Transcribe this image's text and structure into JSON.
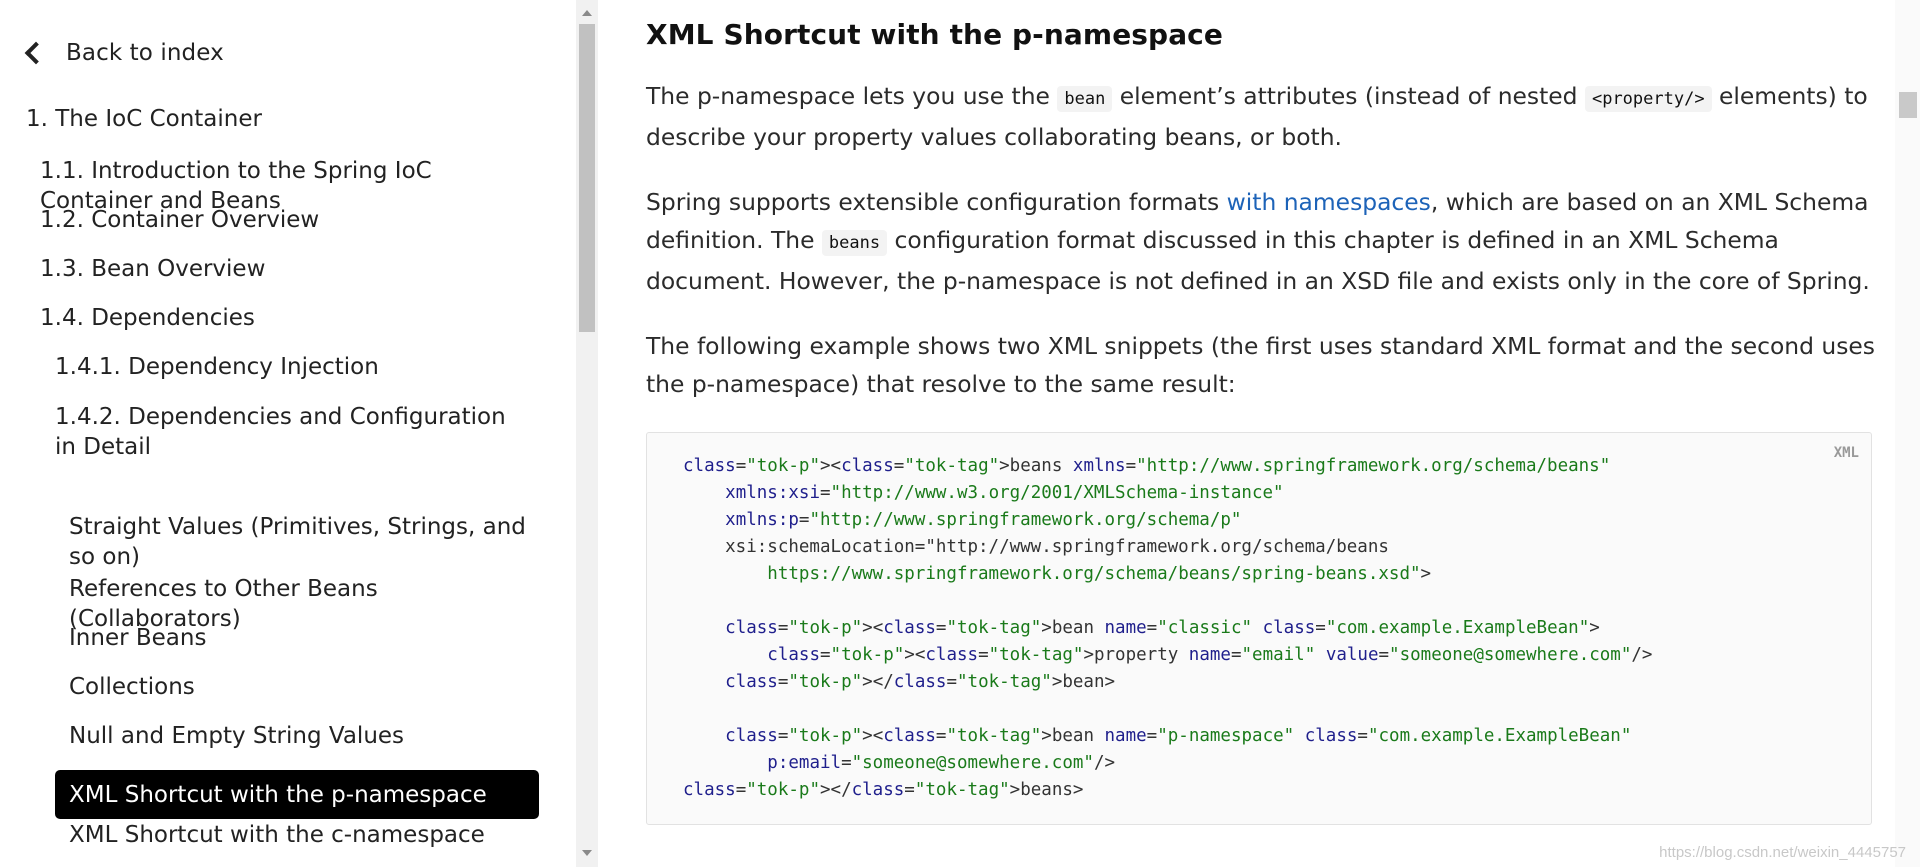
{
  "sidebar": {
    "back_label": "Back to index",
    "toc": [
      {
        "label": "1. The IoC Container",
        "level": 0
      },
      {
        "label": "1.1. Introduction to the Spring IoC Container and Beans",
        "level": 1
      },
      {
        "label": "1.2. Container Overview",
        "level": 1
      },
      {
        "label": "1.3. Bean Overview",
        "level": 1
      },
      {
        "label": "1.4. Dependencies",
        "level": 1
      },
      {
        "label": "1.4.1. Dependency Injection",
        "level": 2
      },
      {
        "label": "1.4.2. Dependencies and Configuration in Detail",
        "level": 2
      },
      {
        "label": "Straight Values (Primitives, Strings, and so on)",
        "level": 3
      },
      {
        "label": "References to Other Beans (Collaborators)",
        "level": 3
      },
      {
        "label": "Inner Beans",
        "level": 3
      },
      {
        "label": "Collections",
        "level": 3
      },
      {
        "label": "Null and Empty String Values",
        "level": 3
      },
      {
        "label": "XML Shortcut with the p-namespace",
        "level": 3,
        "active": true
      },
      {
        "label": "XML Shortcut with the c-namespace",
        "level": 3
      }
    ]
  },
  "content": {
    "title": "XML Shortcut with the p-namespace",
    "p1": {
      "t1": "The p-namespace lets you use the ",
      "code1": "bean",
      "t2": " element’s attributes (instead of nested ",
      "code2": "<property/>",
      "t3": " elements) to describe your property values collaborating beans, or both."
    },
    "p2": {
      "t1": "Spring supports extensible configuration formats ",
      "link": "with namespaces",
      "t2": ", which are based on an XML Schema definition. The ",
      "code1": "beans",
      "t3": " configuration format discussed in this chapter is defined in an XML Schema document. However, the p-namespace is not defined in an XSD file and exists only in the core of Spring."
    },
    "p3": "The following example shows two XML snippets (the first uses standard XML format and the second uses the p-namespace) that resolve to the same result:",
    "code_lang": "XML",
    "code_lines": [
      "<beans xmlns=\"http://www.springframework.org/schema/beans\"",
      "    xmlns:xsi=\"http://www.w3.org/2001/XMLSchema-instance\"",
      "    xmlns:p=\"http://www.springframework.org/schema/p\"",
      "    xsi:schemaLocation=\"http://www.springframework.org/schema/beans",
      "        https://www.springframework.org/schema/beans/spring-beans.xsd\">",
      "",
      "    <bean name=\"classic\" class=\"com.example.ExampleBean\">",
      "        <property name=\"email\" value=\"someone@somewhere.com\"/>",
      "    </bean>",
      "",
      "    <bean name=\"p-namespace\" class=\"com.example.ExampleBean\"",
      "        p:email=\"someone@somewhere.com\"/>",
      "</beans>"
    ]
  },
  "watermark": "https://blog.csdn.net/weixin_4445757"
}
